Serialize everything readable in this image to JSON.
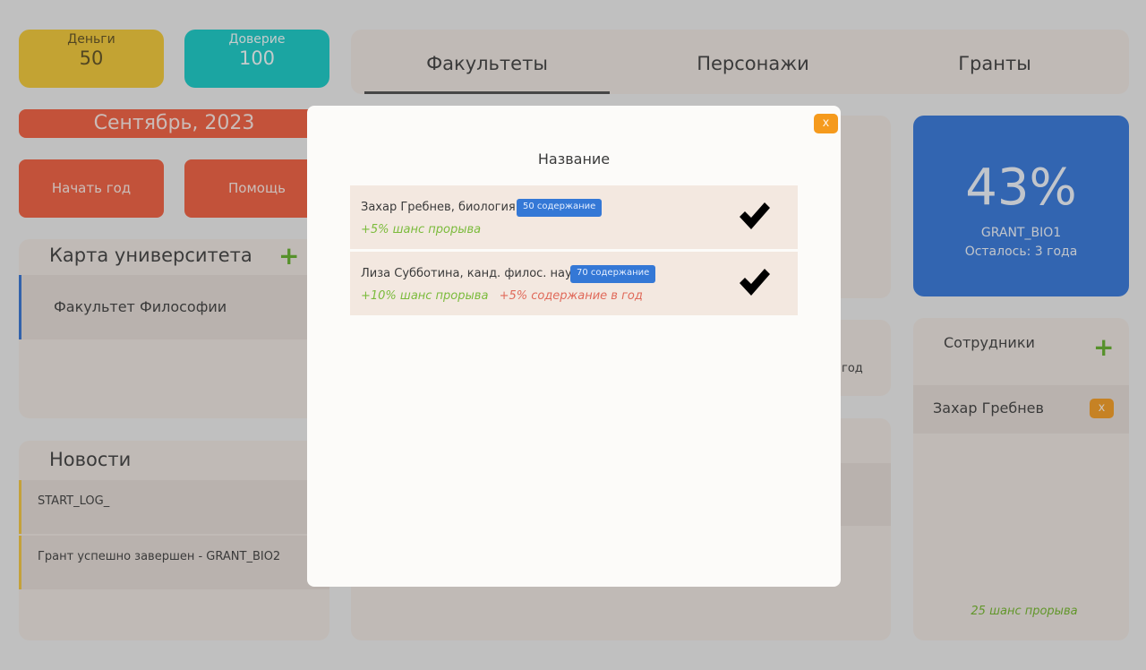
{
  "resources": {
    "money_label": "Деньги",
    "money_value": "50",
    "trust_label": "Доверие",
    "trust_value": "100"
  },
  "date": "Сентябрь, 2023",
  "buttons": {
    "start_year": "Начать год",
    "help": "Помощь"
  },
  "map": {
    "title": "Карта университета",
    "add": "+",
    "items": [
      {
        "label": "Факультет Философии"
      }
    ]
  },
  "news": {
    "title": "Новости",
    "items": [
      {
        "text": "START_LOG_"
      },
      {
        "text": "Грант успешно завершен - GRANT_BIO2"
      }
    ]
  },
  "tabs": [
    {
      "label": "Факультеты",
      "active": true
    },
    {
      "label": "Персонажи"
    },
    {
      "label": "Гранты"
    }
  ],
  "mid": {
    "partial_text": "год"
  },
  "grant": {
    "percent": "43%",
    "name": "GRANT_BIO1",
    "remaining": "Осталось: 3 года"
  },
  "staff": {
    "title": "Сотрудники",
    "add": "+",
    "members": [
      {
        "name": "Захар Гребнев",
        "remove": "x"
      }
    ],
    "chance": "25 шанс прорыва"
  },
  "modal": {
    "close": "x",
    "title": "Название",
    "rows": [
      {
        "name": "Захар Гребнев, биология",
        "badge": "50 содержание",
        "good": "+5% шанс прорыва",
        "bad": ""
      },
      {
        "name": "Лиза Субботина, канд. филос. наук",
        "badge": "70 содержание",
        "good": "+10% шанс прорыва",
        "bad": "+5% содержание в год"
      }
    ]
  },
  "colors": {
    "money": "#f0c630",
    "trust": "#11c8c4",
    "red": "#ef5a3a",
    "blue": "#2f73d9",
    "orange": "#f59a1d",
    "green": "#5fae26"
  },
  "icons": {
    "add": "plus-icon",
    "confirm": "checkmark-icon",
    "close": "close-icon"
  }
}
